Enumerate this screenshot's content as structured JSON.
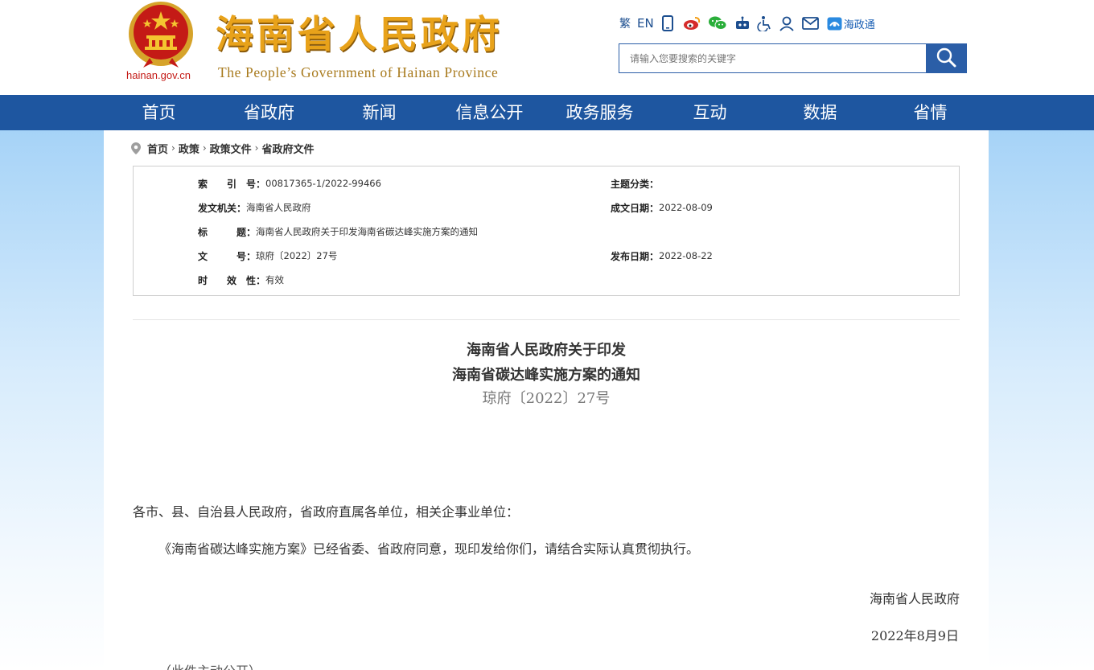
{
  "header": {
    "site_title_cn": "海南省人民政府",
    "site_title_en": "The People’s Government  of Hainan Province",
    "site_domain": "hainan.gov.cn",
    "toolbar": {
      "traditional": "繁",
      "english": "EN",
      "haizhengtong": "海政通",
      "icons": [
        "mobile-icon",
        "weibo-icon",
        "wechat-icon",
        "robot-icon",
        "accessibility-icon",
        "user-icon",
        "mail-icon",
        "haizhengtong-icon"
      ]
    },
    "search": {
      "placeholder": "请输入您要搜索的关键字"
    },
    "colors": {
      "nav_bg": "#1e56a0",
      "title_gold": "#e8a21a",
      "emblem_red": "#c41a16"
    }
  },
  "nav": {
    "items": [
      "首页",
      "省政府",
      "新闻",
      "信息公开",
      "政务服务",
      "互动",
      "数据",
      "省情"
    ]
  },
  "breadcrumb": [
    "首页",
    "政策",
    "政策文件",
    "省政府文件"
  ],
  "meta": {
    "index_label": "索　　引　号：",
    "index_value": "00817365-1/2022-99466",
    "category_label": "主题分类：",
    "category_value": "",
    "issuer_label": "发文机关：",
    "issuer_value": "海南省人民政府",
    "created_label": "成文日期：",
    "created_value": "2022-08-09",
    "title_label": "标　　　题：",
    "title_value": "海南省人民政府关于印发海南省碳达峰实施方案的通知",
    "docno_label": "文　　　号：",
    "docno_value": "琼府〔2022〕27号",
    "published_label": "发布日期：",
    "published_value": "2022-08-22",
    "validity_label": "时　　效　性：",
    "validity_value": "有效"
  },
  "document": {
    "title_line1": "海南省人民政府关于印发",
    "title_line2": "海南省碳达峰实施方案的通知",
    "number": "琼府〔2022〕27号",
    "salutation": "各市、县、自治县人民政府，省政府直属各单位，相关企事业单位：",
    "paragraph1": "《海南省碳达峰实施方案》已经省委、省政府同意，现印发给你们，请结合实际认真贯彻执行。",
    "signer": "海南省人民政府",
    "sign_date": "2022年8月9日",
    "footnote": "（此件主动公开）"
  }
}
